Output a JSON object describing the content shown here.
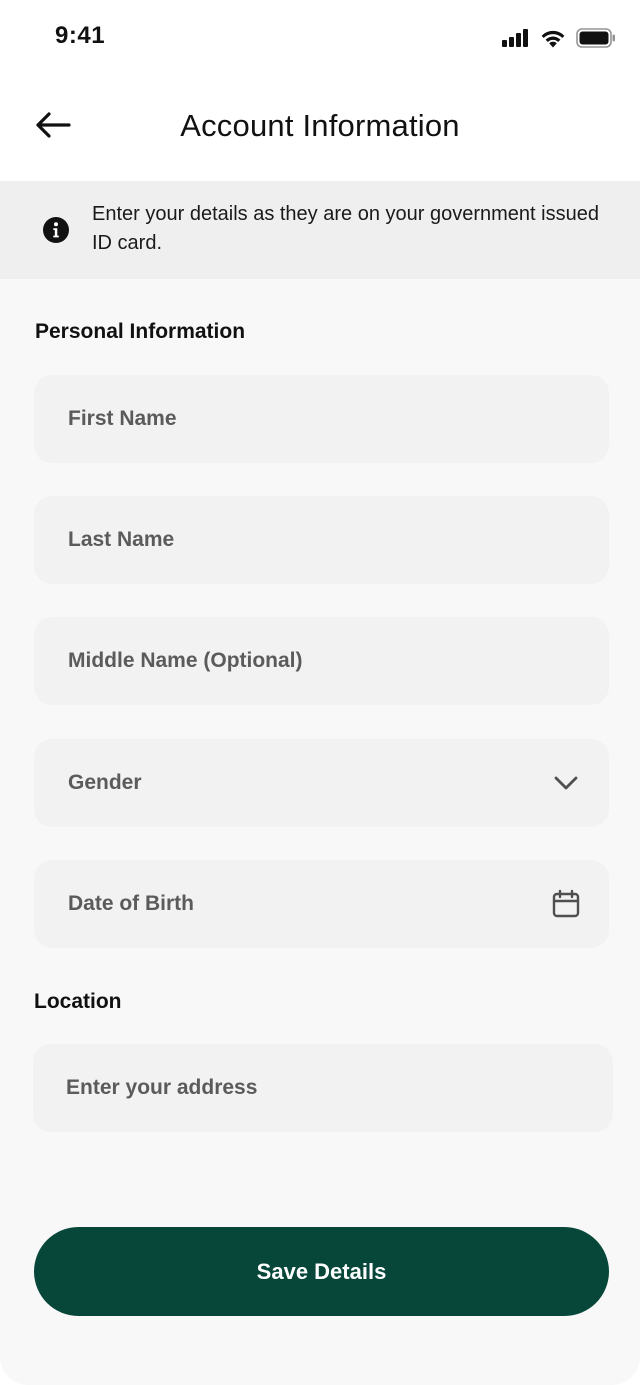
{
  "status_bar": {
    "time": "9:41"
  },
  "header": {
    "title": "Account Information"
  },
  "notice": {
    "text": "Enter your details as they are on your government issued ID card."
  },
  "personal": {
    "heading": "Personal Information",
    "first_name": {
      "placeholder": "First Name"
    },
    "last_name": {
      "placeholder": "Last Name"
    },
    "middle_name": {
      "placeholder": "Middle Name (Optional)"
    },
    "gender": {
      "placeholder": "Gender",
      "icon": "chevron-down-icon"
    },
    "dob": {
      "placeholder": "Date of Birth",
      "icon": "calendar-icon"
    }
  },
  "location": {
    "heading": "Location",
    "address": {
      "placeholder": "Enter your address"
    }
  },
  "actions": {
    "save_label": "Save Details"
  },
  "colors": {
    "primary": "#06473a",
    "field_bg": "#f2f2f2",
    "page_bg": "#f8f8f8",
    "notice_bg": "#efefef"
  }
}
